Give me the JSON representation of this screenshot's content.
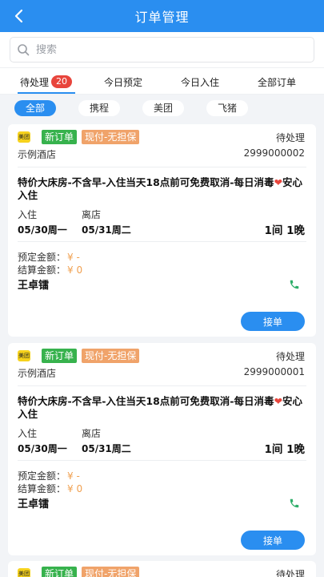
{
  "header": {
    "title": "订单管理",
    "back_icon": "chevron-left-icon"
  },
  "search": {
    "placeholder": "搜索",
    "value": ""
  },
  "tabs": [
    {
      "label": "待处理",
      "badge": "20",
      "active": true
    },
    {
      "label": "今日预定"
    },
    {
      "label": "今日入住"
    },
    {
      "label": "全部订单"
    }
  ],
  "filters": [
    {
      "label": "全部",
      "active": true
    },
    {
      "label": "携程"
    },
    {
      "label": "美团"
    },
    {
      "label": "飞猪"
    }
  ],
  "orders": [
    {
      "platform_logo": "美团",
      "tag_new": "新订单",
      "tag_payment": "现付-无担保",
      "status": "待处理",
      "hotel": "示例酒店",
      "order_no": "2999000002",
      "room_title": "特价大床房-不含早-入住当天18点前可免费取消-每日消毒",
      "room_title_heart": "❤",
      "room_title_tail": "安心入住",
      "checkin_label": "入住",
      "checkout_label": "离店",
      "checkin_date": "05/30周一",
      "checkout_date": "05/31周二",
      "rooms_nights": "1间  1晚",
      "booking_amount_label": "预定金额：",
      "booking_amount": "¥ -",
      "settle_amount_label": "结算金额：",
      "settle_amount": "¥ 0",
      "guest": "王卓镭",
      "accept_label": "接单"
    },
    {
      "platform_logo": "美团",
      "tag_new": "新订单",
      "tag_payment": "现付-无担保",
      "status": "待处理",
      "hotel": "示例酒店",
      "order_no": "2999000001",
      "room_title": "特价大床房-不含早-入住当天18点前可免费取消-每日消毒",
      "room_title_heart": "❤",
      "room_title_tail": "安心入住",
      "checkin_label": "入住",
      "checkout_label": "离店",
      "checkin_date": "05/30周一",
      "checkout_date": "05/31周二",
      "rooms_nights": "1间  1晚",
      "booking_amount_label": "预定金额：",
      "booking_amount": "¥ -",
      "settle_amount_label": "结算金额：",
      "settle_amount": "¥ 0",
      "guest": "王卓镭",
      "accept_label": "接单"
    },
    {
      "platform_logo": "美团",
      "tag_new": "新订单",
      "tag_payment": "现付-无担保",
      "status": "待处理"
    }
  ],
  "colors": {
    "primary": "#2a8ef0",
    "new_tag": "#37b24d",
    "pay_tag": "#f0a36a",
    "badge": "#e8453c",
    "amount": "#f0a050",
    "phone": "#2fae6a"
  }
}
